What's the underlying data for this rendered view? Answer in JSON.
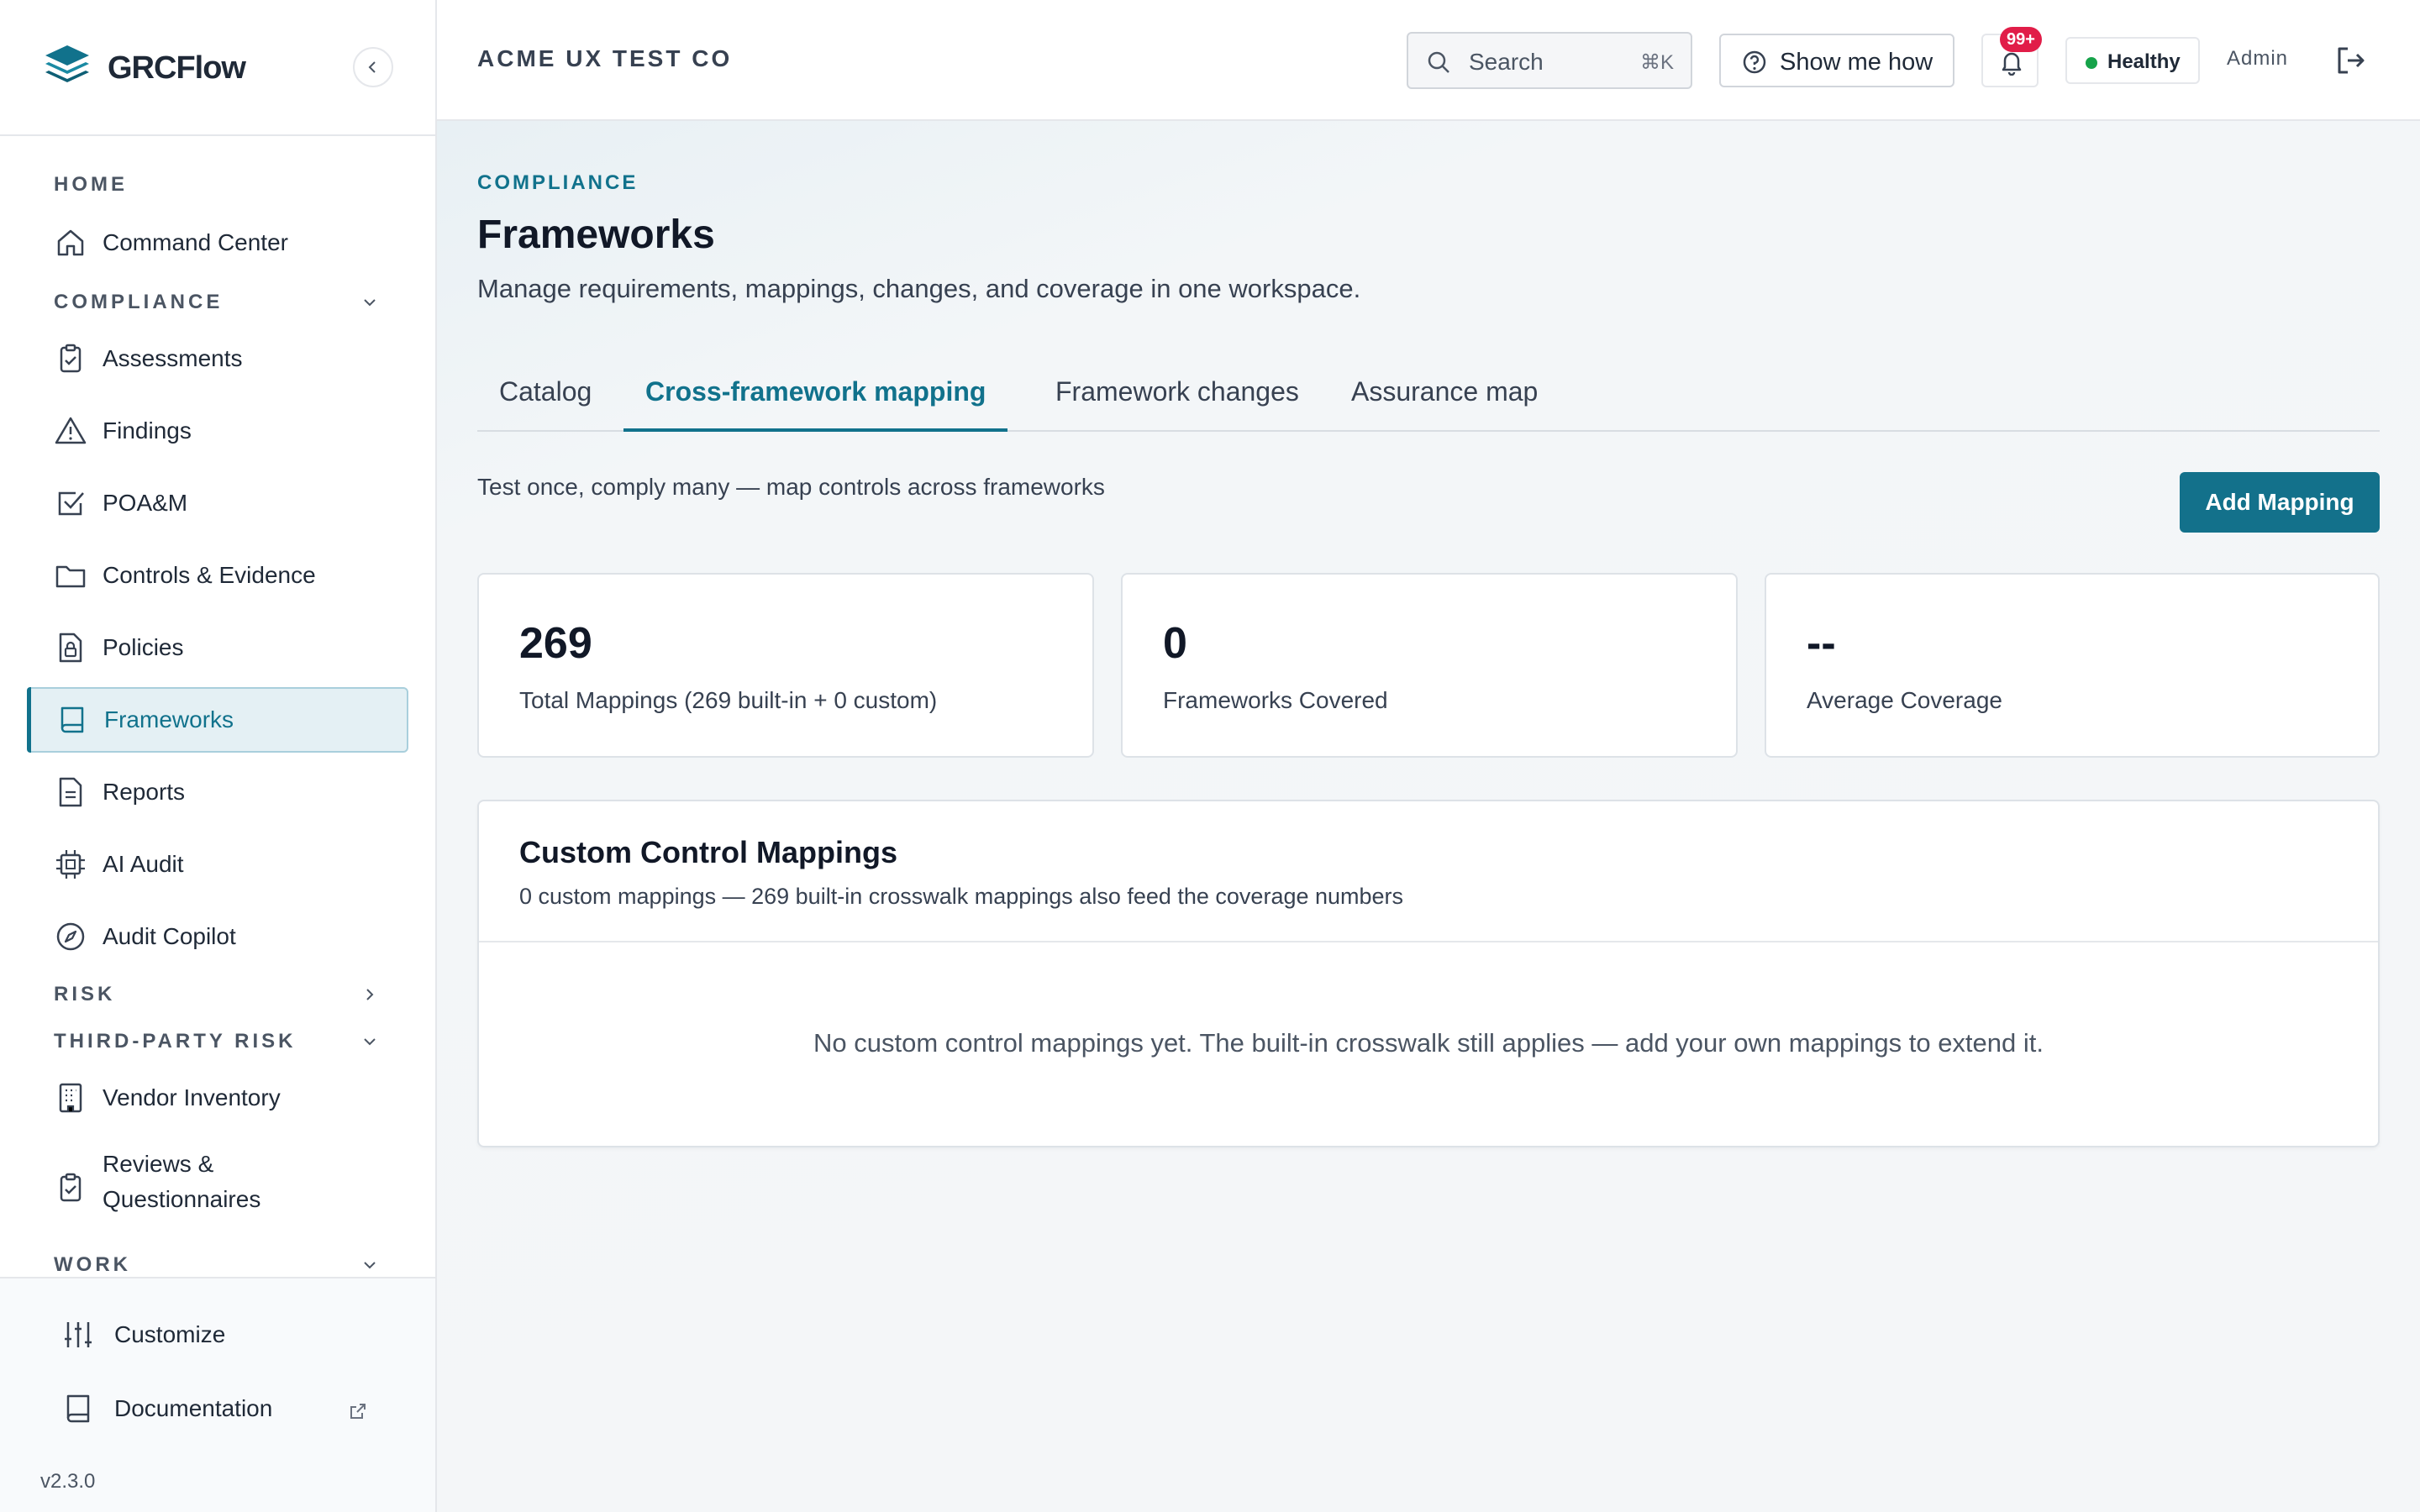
{
  "app": {
    "name": "GRCFlow",
    "version": "v2.3.0"
  },
  "topbar": {
    "org_name": "ACME UX TEST CO",
    "search_placeholder": "Search",
    "search_shortcut": "⌘K",
    "show_me_how": "Show me how",
    "notifications_badge": "99+",
    "health_status": "Healthy",
    "user_role": "Admin"
  },
  "sidebar": {
    "sections": {
      "home": "HOME",
      "compliance": "COMPLIANCE",
      "risk": "RISK",
      "third_party_risk": "THIRD-PARTY RISK",
      "work": "WORK"
    },
    "items": {
      "command_center": "Command Center",
      "assessments": "Assessments",
      "findings": "Findings",
      "poam": "POA&M",
      "controls_evidence": "Controls & Evidence",
      "policies": "Policies",
      "frameworks": "Frameworks",
      "reports": "Reports",
      "ai_audit": "AI Audit",
      "audit_copilot": "Audit Copilot",
      "vendor_inventory": "Vendor Inventory",
      "reviews_line1": "Reviews &",
      "reviews_line2": "Questionnaires"
    },
    "active_item": "Frameworks",
    "footer": {
      "customize": "Customize",
      "documentation": "Documentation"
    }
  },
  "page": {
    "eyebrow": "COMPLIANCE",
    "title": "Frameworks",
    "subtitle": "Manage requirements, mappings, changes, and coverage in one workspace.",
    "tabs": [
      "Catalog",
      "Cross-framework mapping",
      "Framework changes",
      "Assurance map"
    ],
    "active_tab": "Cross-framework mapping",
    "tagline": "Test once, comply many — map controls across frameworks",
    "add_button": "Add Mapping",
    "stats": [
      {
        "value": "269",
        "label": "Total Mappings (269 built-in + 0 custom)"
      },
      {
        "value": "0",
        "label": "Frameworks Covered"
      },
      {
        "value": "--",
        "label": "Average Coverage"
      }
    ],
    "panel": {
      "title": "Custom Control Mappings",
      "subtitle": "0 custom mappings — 269 built-in crosswalk mappings also feed the coverage numbers",
      "empty_message": "No custom control mappings yet. The built-in crosswalk still applies — add your own mappings to extend it."
    }
  },
  "colors": {
    "accent": "#11728c",
    "button": "#13718b",
    "badge": "#e11d48",
    "healthy": "#16a34a"
  }
}
